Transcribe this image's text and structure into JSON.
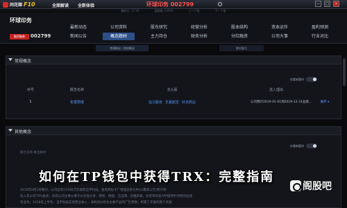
{
  "topbar": {
    "app_name": "同花顺",
    "app_f10": "F10",
    "brand": "全面解读",
    "inst": "全新体验",
    "title": "环球印务 002799",
    "window_buttons": [
      "—",
      "□",
      "×"
    ]
  },
  "watermark_bar": {
    "items": [
      "最新价: 17.20",
      "涨跌幅: 0.00%",
      "上一个股",
      "下一个股"
    ]
  },
  "stock": {
    "name": "环球印务",
    "tag": "融资融券",
    "code": "002799"
  },
  "nav": {
    "items": [
      {
        "label": "最新动态",
        "active": false
      },
      {
        "label": "公司资料",
        "active": false
      },
      {
        "label": "股东研究",
        "active": false
      },
      {
        "label": "经营分析",
        "active": false
      },
      {
        "label": "股本结构",
        "active": false
      },
      {
        "label": "资本运作",
        "active": false
      },
      {
        "label": "盈利预测",
        "active": false
      },
      {
        "label": "新闻公告",
        "active": false
      },
      {
        "label": "概念题材",
        "active": true
      },
      {
        "label": "主力持仓",
        "active": false
      },
      {
        "label": "财务分析",
        "active": false
      },
      {
        "label": "分红融资",
        "active": false
      },
      {
        "label": "公司大事",
        "active": false
      },
      {
        "label": "行业对比",
        "active": false
      }
    ],
    "subnav": "常规概念 | 其他概念",
    "subnav2": "题材要点"
  },
  "panel1": {
    "title": "常规概念",
    "toggle_label": "仅看新题材",
    "headers": [
      "序号",
      "概念名称",
      "龙头股",
      "选入理由",
      ""
    ],
    "rows": [
      {
        "index": "1",
        "concept": "年报预增",
        "leaders": [
          "征江股份",
          "华夏航空",
          "红日药业"
        ],
        "reason": "公司预计2019-01-01到2019-12-31业绩...",
        "expand": "展开 ▾"
      }
    ]
  },
  "panel2": {
    "title": "其他概念",
    "toggle_label": "仅看新题材",
    "lines": [
      "概念名称   概念解析",
      "2018年8月2日晚间，公司出资13186万元收购当宇科技，金高目标于厂增强竞争力中心(最新公告)原计划",
      "投入及公司70%股权，标的公司主要从事于从社会头条、网易、搜狐、当当网、凤凰新闻、抖音等知名APP提供针对性的投放",
      "等业务，2018年上半年，当宇科技实现营业收入，净利润分别为主要产品的广告营销，积累了丰富的客户资源"
    ]
  },
  "overlay": {
    "title": "如何在TP钱包中获得TRX：完整指南",
    "watermark_text": "阁股吧",
    "watermark_icon": "site-logo-icon"
  }
}
